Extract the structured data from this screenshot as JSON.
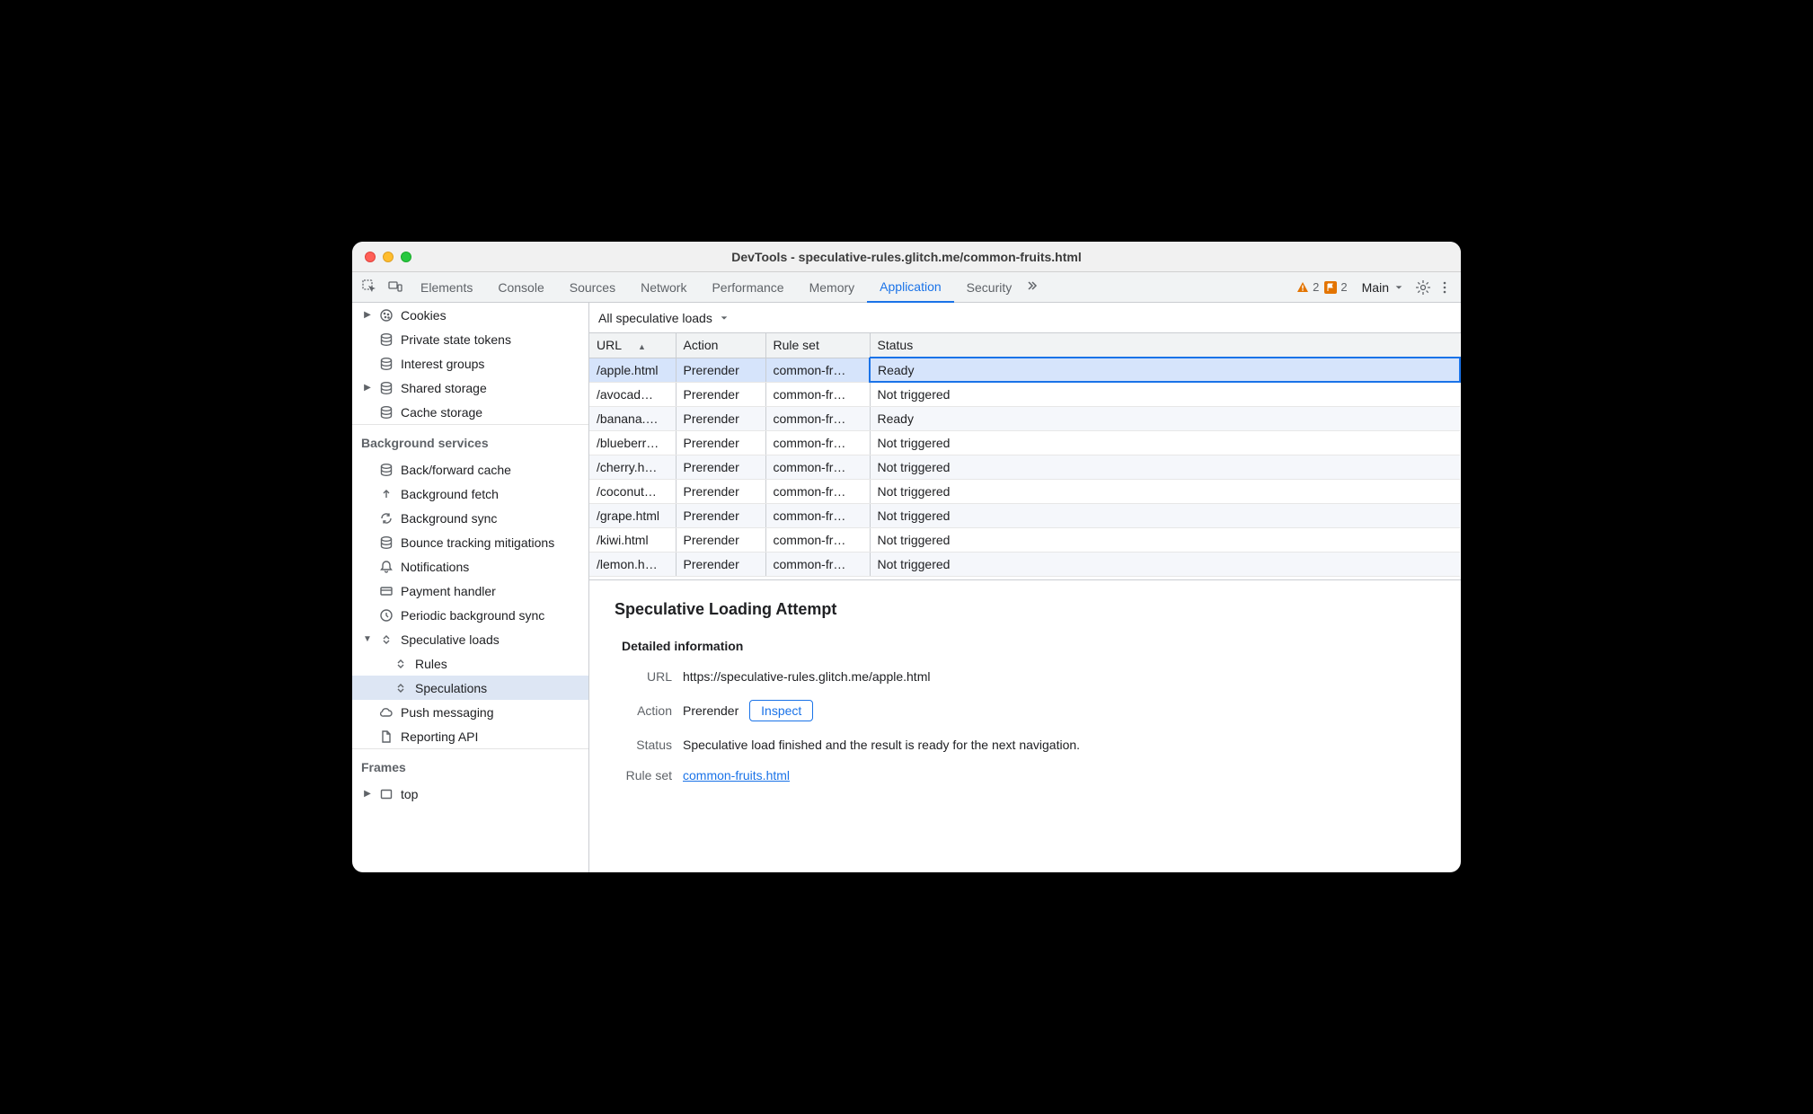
{
  "window_title": "DevTools - speculative-rules.glitch.me/common-fruits.html",
  "tabs": [
    "Elements",
    "Console",
    "Sources",
    "Network",
    "Performance",
    "Memory",
    "Application",
    "Security"
  ],
  "active_tab": "Application",
  "warnings_count": "2",
  "breakpoints_count": "2",
  "target_dropdown": "Main",
  "sidebar": {
    "storage": [
      {
        "label": "Cookies",
        "tri": "▶",
        "icon": "cookie"
      },
      {
        "label": "Private state tokens",
        "icon": "db"
      },
      {
        "label": "Interest groups",
        "icon": "db"
      },
      {
        "label": "Shared storage",
        "tri": "▶",
        "icon": "db"
      },
      {
        "label": "Cache storage",
        "icon": "db"
      }
    ],
    "bg_title": "Background services",
    "bg": [
      {
        "label": "Back/forward cache",
        "icon": "db"
      },
      {
        "label": "Background fetch",
        "icon": "bfetch"
      },
      {
        "label": "Background sync",
        "icon": "sync"
      },
      {
        "label": "Bounce tracking mitigations",
        "icon": "db"
      },
      {
        "label": "Notifications",
        "icon": "bell"
      },
      {
        "label": "Payment handler",
        "icon": "card"
      },
      {
        "label": "Periodic background sync",
        "icon": "clock"
      },
      {
        "label": "Speculative loads",
        "icon": "updown",
        "tri": "▼",
        "expanded": true
      },
      {
        "label": "Rules",
        "icon": "updown",
        "indent": true
      },
      {
        "label": "Speculations",
        "icon": "updown",
        "indent": true,
        "selected": true
      },
      {
        "label": "Push messaging",
        "icon": "cloud"
      },
      {
        "label": "Reporting API",
        "icon": "file"
      }
    ],
    "frames_title": "Frames",
    "frames": [
      {
        "label": "top",
        "tri": "▶",
        "icon": "frame"
      }
    ]
  },
  "filter_label": "All speculative loads",
  "columns": [
    "URL",
    "Action",
    "Rule set",
    "Status"
  ],
  "rows": [
    {
      "url": "/apple.html",
      "action": "Prerender",
      "ruleset": "common-fr…",
      "status": "Ready",
      "active": true
    },
    {
      "url": "/avocad…",
      "action": "Prerender",
      "ruleset": "common-fr…",
      "status": "Not triggered"
    },
    {
      "url": "/banana.…",
      "action": "Prerender",
      "ruleset": "common-fr…",
      "status": "Ready"
    },
    {
      "url": "/blueberr…",
      "action": "Prerender",
      "ruleset": "common-fr…",
      "status": "Not triggered"
    },
    {
      "url": "/cherry.h…",
      "action": "Prerender",
      "ruleset": "common-fr…",
      "status": "Not triggered"
    },
    {
      "url": "/coconut…",
      "action": "Prerender",
      "ruleset": "common-fr…",
      "status": "Not triggered"
    },
    {
      "url": "/grape.html",
      "action": "Prerender",
      "ruleset": "common-fr…",
      "status": "Not triggered"
    },
    {
      "url": "/kiwi.html",
      "action": "Prerender",
      "ruleset": "common-fr…",
      "status": "Not triggered"
    },
    {
      "url": "/lemon.h…",
      "action": "Prerender",
      "ruleset": "common-fr…",
      "status": "Not triggered"
    }
  ],
  "details": {
    "heading": "Speculative Loading Attempt",
    "sub": "Detailed information",
    "url_label": "URL",
    "url_value": "https://speculative-rules.glitch.me/apple.html",
    "action_label": "Action",
    "action_value": "Prerender",
    "inspect": "Inspect",
    "status_label": "Status",
    "status_value": "Speculative load finished and the result is ready for the next navigation.",
    "ruleset_label": "Rule set",
    "ruleset_value": "common-fruits.html"
  }
}
